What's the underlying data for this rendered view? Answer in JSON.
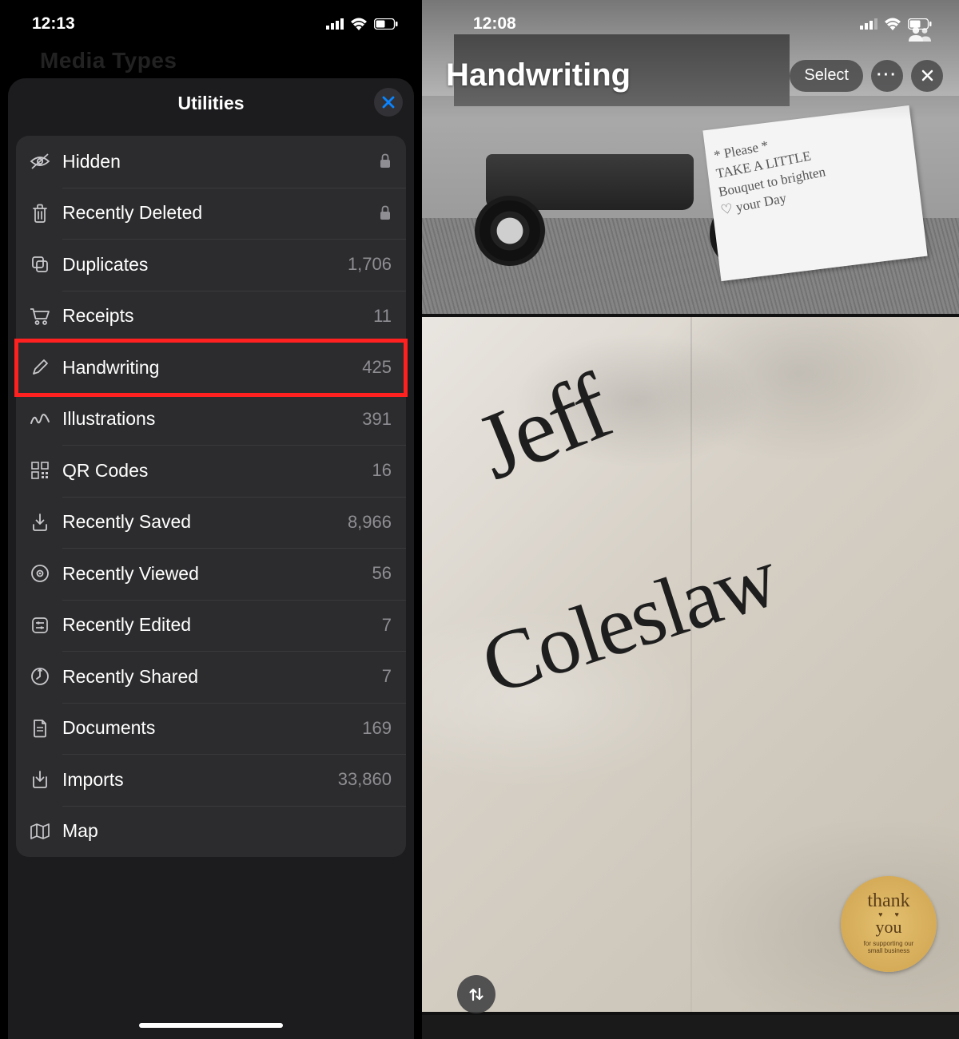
{
  "left": {
    "status_time": "12:13",
    "bg_title": "Media Types",
    "sheet_title": "Utilities",
    "items": [
      {
        "icon": "eye-slash-icon",
        "label": "Hidden",
        "count": "",
        "locked": true
      },
      {
        "icon": "trash-icon",
        "label": "Recently Deleted",
        "count": "",
        "locked": true
      },
      {
        "icon": "duplicate-icon",
        "label": "Duplicates",
        "count": "1,706",
        "locked": false
      },
      {
        "icon": "cart-icon",
        "label": "Receipts",
        "count": "11",
        "locked": false
      },
      {
        "icon": "pencil-icon",
        "label": "Handwriting",
        "count": "425",
        "locked": false,
        "highlighted": true
      },
      {
        "icon": "scribble-icon",
        "label": "Illustrations",
        "count": "391",
        "locked": false
      },
      {
        "icon": "qr-icon",
        "label": "QR Codes",
        "count": "16",
        "locked": false
      },
      {
        "icon": "download-icon",
        "label": "Recently Saved",
        "count": "8,966",
        "locked": false
      },
      {
        "icon": "eye-circle-icon",
        "label": "Recently Viewed",
        "count": "56",
        "locked": false
      },
      {
        "icon": "adjust-icon",
        "label": "Recently Edited",
        "count": "7",
        "locked": false
      },
      {
        "icon": "share-clock-icon",
        "label": "Recently Shared",
        "count": "7",
        "locked": false
      },
      {
        "icon": "document-icon",
        "label": "Documents",
        "count": "169",
        "locked": false
      },
      {
        "icon": "import-icon",
        "label": "Imports",
        "count": "33,860",
        "locked": false
      },
      {
        "icon": "map-icon",
        "label": "Map",
        "count": "",
        "locked": false
      }
    ]
  },
  "right": {
    "status_time": "12:08",
    "title": "Handwriting",
    "select_label": "Select",
    "photo1_sign_lines": [
      "* Please *",
      "TAKE A LITTLE",
      "Bouquet to brighten",
      "♡ your Day"
    ],
    "photo2_text1": "Jeff",
    "photo2_text2": "Coleslaw",
    "sticker_line1": "thank",
    "sticker_line2": "you",
    "sticker_line3": "for supporting our\nsmall business"
  }
}
